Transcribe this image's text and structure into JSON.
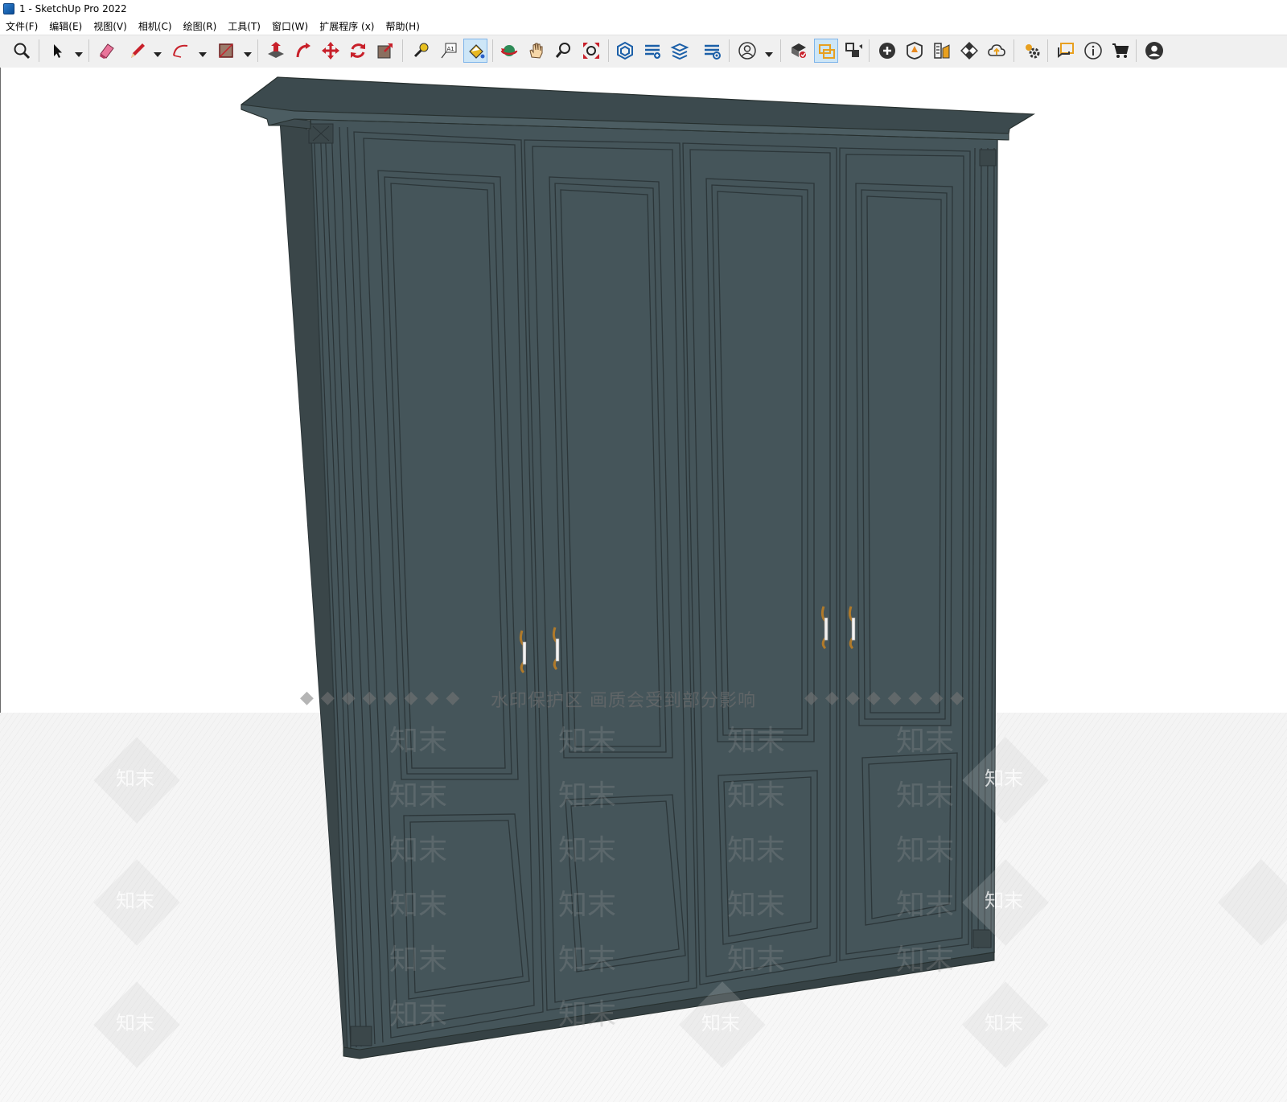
{
  "window": {
    "title": "1 - SketchUp Pro 2022"
  },
  "menu": {
    "items": [
      "文件(F)",
      "编辑(E)",
      "视图(V)",
      "相机(C)",
      "绘图(R)",
      "工具(T)",
      "窗口(W)",
      "扩展程序 (x)",
      "帮助(H)"
    ]
  },
  "toolbar": {
    "tools": [
      "zoom-icon",
      "select-icon",
      "eraser-icon",
      "pencil-line-icon",
      "arc-icon",
      "rectangle-icon",
      "push-pull-icon",
      "follow-me-icon",
      "move-icon",
      "rotate-icon",
      "scale-icon",
      "tape-measure-icon",
      "text-icon",
      "paint-bucket-icon",
      "orbit-icon",
      "pan-icon",
      "zoom-window-icon",
      "zoom-extents-icon",
      "3d-warehouse-icon",
      "extension-warehouse-icon",
      "layout-icon",
      "extension-manager-icon",
      "user-icon",
      "solid-tools-icon",
      "section-plane-icon",
      "section-display-icon",
      "add-location-icon",
      "sandbox-icon",
      "style-builder-icon",
      "checkerboard-icon",
      "cloud-icon",
      "settings-icon",
      "message-icon",
      "info-icon",
      "cart-icon",
      "account-icon"
    ],
    "active_tool": "paint-bucket-icon"
  },
  "viewport": {
    "watermark_notice": "水印保护区  画质会受到部分影响",
    "watermark_brand": "知末",
    "model_color": "#465559"
  }
}
